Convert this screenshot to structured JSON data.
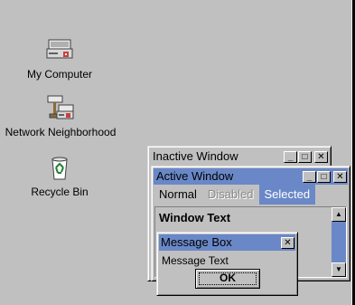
{
  "desktop": {
    "icons": [
      {
        "label": "My Computer",
        "icon": "computer-icon"
      },
      {
        "label": "Network Neighborhood",
        "icon": "network-icon"
      },
      {
        "label": "Recycle Bin",
        "icon": "recycle-bin-icon"
      }
    ],
    "background_color": "#c0c0c0"
  },
  "inactive_window": {
    "title": "Inactive Window",
    "buttons": [
      "minimize",
      "maximize",
      "close"
    ]
  },
  "active_window": {
    "title": "Active Window",
    "menu": [
      {
        "label": "Normal",
        "state": "normal"
      },
      {
        "label": "Disabled",
        "state": "disabled"
      },
      {
        "label": "Selected",
        "state": "selected"
      }
    ],
    "window_text": "Window Text",
    "scroll_up_glyph": "▲",
    "scroll_down_glyph": "▼"
  },
  "message_box": {
    "title": "Message Box",
    "text": "Message Text",
    "ok_label": "OK"
  },
  "glyphs": {
    "minimize": "_",
    "maximize": "□",
    "close": "✕"
  },
  "colors": {
    "selection": "#6a88c8",
    "face": "#c0c0c0"
  }
}
